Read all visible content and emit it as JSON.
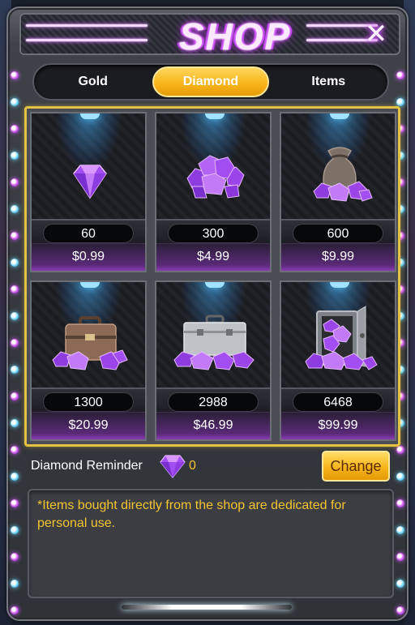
{
  "header": {
    "title": "SHOP",
    "close_label": "✕"
  },
  "tabs": [
    {
      "label": "Gold",
      "active": false
    },
    {
      "label": "Diamond",
      "active": true
    },
    {
      "label": "Items",
      "active": false
    }
  ],
  "products": [
    {
      "quantity": "60",
      "price": "$0.99",
      "icon": "single-gem-icon"
    },
    {
      "quantity": "300",
      "price": "$4.99",
      "icon": "gem-pile-icon"
    },
    {
      "quantity": "600",
      "price": "$9.99",
      "icon": "gem-sack-icon"
    },
    {
      "quantity": "1300",
      "price": "$20.99",
      "icon": "gem-briefcase-icon"
    },
    {
      "quantity": "2988",
      "price": "$46.99",
      "icon": "gem-suitcase-icon"
    },
    {
      "quantity": "6468",
      "price": "$99.99",
      "icon": "gem-vault-icon"
    }
  ],
  "reminder": {
    "label": "Diamond Reminder",
    "count": "0",
    "change_label": "Change"
  },
  "notice": {
    "text": "*Items bought directly from the shop are dedicated for personal use."
  },
  "colors": {
    "accent_gold": "#f3c531",
    "neon_purple": "#d45cff",
    "gem_purple": "#a34ef2"
  }
}
